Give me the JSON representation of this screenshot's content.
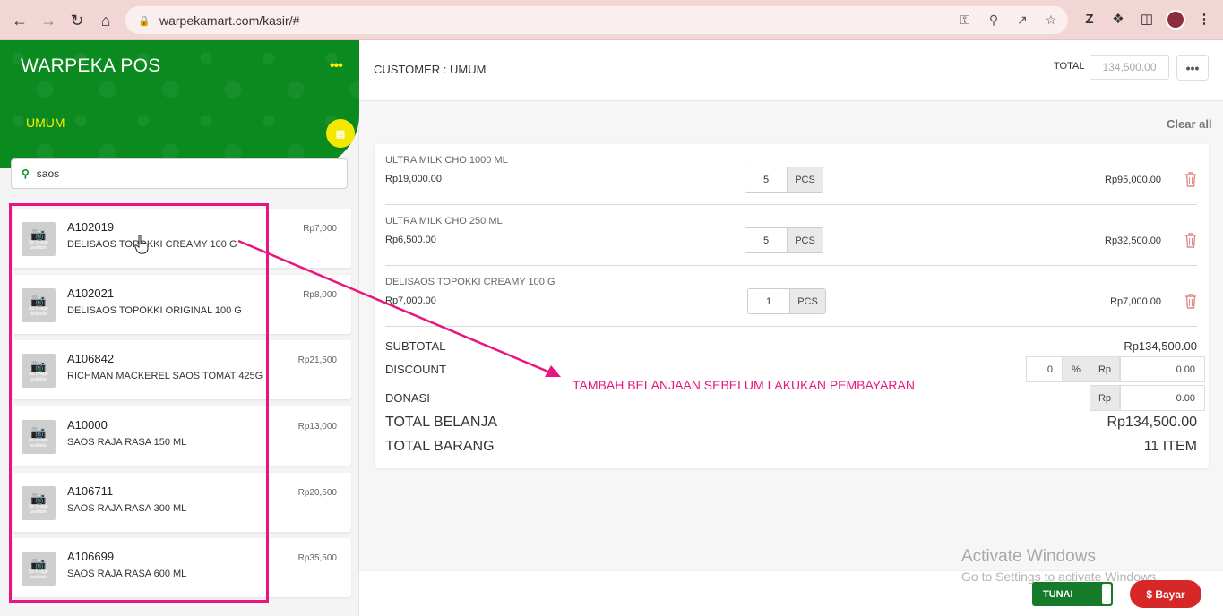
{
  "browser": {
    "url": "warpekamart.com/kasir/#"
  },
  "sidebar": {
    "title": "WARPEKA POS",
    "menu_glyph": "•••",
    "customer_label": "UMUM",
    "search_value": "saos",
    "products": [
      {
        "code": "A102019",
        "name": "DELISAOS TOPOKKI CREAMY 100 G",
        "price": "Rp7,000"
      },
      {
        "code": "A102021",
        "name": "DELISAOS TOPOKKI ORIGINAL 100 G",
        "price": "Rp8,000"
      },
      {
        "code": "A106842",
        "name": "RICHMAN MACKEREL SAOS TOMAT 425G",
        "price": "Rp21,500"
      },
      {
        "code": "A10000",
        "name": "SAOS RAJA RASA 150 ML",
        "price": "Rp13,000"
      },
      {
        "code": "A106711",
        "name": "SAOS RAJA RASA 300 ML",
        "price": "Rp20,500"
      },
      {
        "code": "A106699",
        "name": "SAOS RAJA RASA 600 ML",
        "price": "Rp35,500"
      }
    ],
    "no_image_text": "No Image available"
  },
  "header": {
    "customer": "CUSTOMER : UMUM",
    "total_label": "TOTAL",
    "total_value": "134,500.00",
    "more_glyph": "•••"
  },
  "cart": {
    "clear_all": "Clear all",
    "items": [
      {
        "name": "ULTRA MILK CHO 1000 ML",
        "price": "Rp19,000.00",
        "qty": "5",
        "unit": "PCS",
        "total": "Rp95,000.00"
      },
      {
        "name": "ULTRA MILK CHO 250 ML",
        "price": "Rp6,500.00",
        "qty": "5",
        "unit": "PCS",
        "total": "Rp32,500.00"
      },
      {
        "name": "DELISAOS TOPOKKI CREAMY 100 G",
        "price": "Rp7,000.00",
        "qty": "1",
        "unit": "PCS",
        "total": "Rp7,000.00"
      }
    ],
    "subtotal_label": "SUBTOTAL",
    "subtotal_value": "Rp134,500.00",
    "discount_label": "DISCOUNT",
    "discount_pct": "0",
    "pct_sign": "%",
    "rp_label": "Rp",
    "discount_amount": "0.00",
    "donasi_label": "DONASI",
    "donasi_amount": "0.00",
    "total_belanja_label": "TOTAL BELANJA",
    "total_belanja_value": "Rp134,500.00",
    "total_barang_label": "TOTAL BARANG",
    "total_barang_value": "11 ITEM"
  },
  "annotation": "TAMBAH BELANJAAN SEBELUM LAKUKAN PEMBAYARAN",
  "footer": {
    "payment_toggle": "TUNAI",
    "pay_button": "$ Bayar"
  },
  "watermark": {
    "line1": "Activate Windows",
    "line2": "Go to Settings to activate Windows."
  },
  "colors": {
    "brand_green": "#0a8a1f",
    "accent_yellow": "#ffee00",
    "annotation_pink": "#e8157f",
    "pay_red": "#d62828"
  }
}
